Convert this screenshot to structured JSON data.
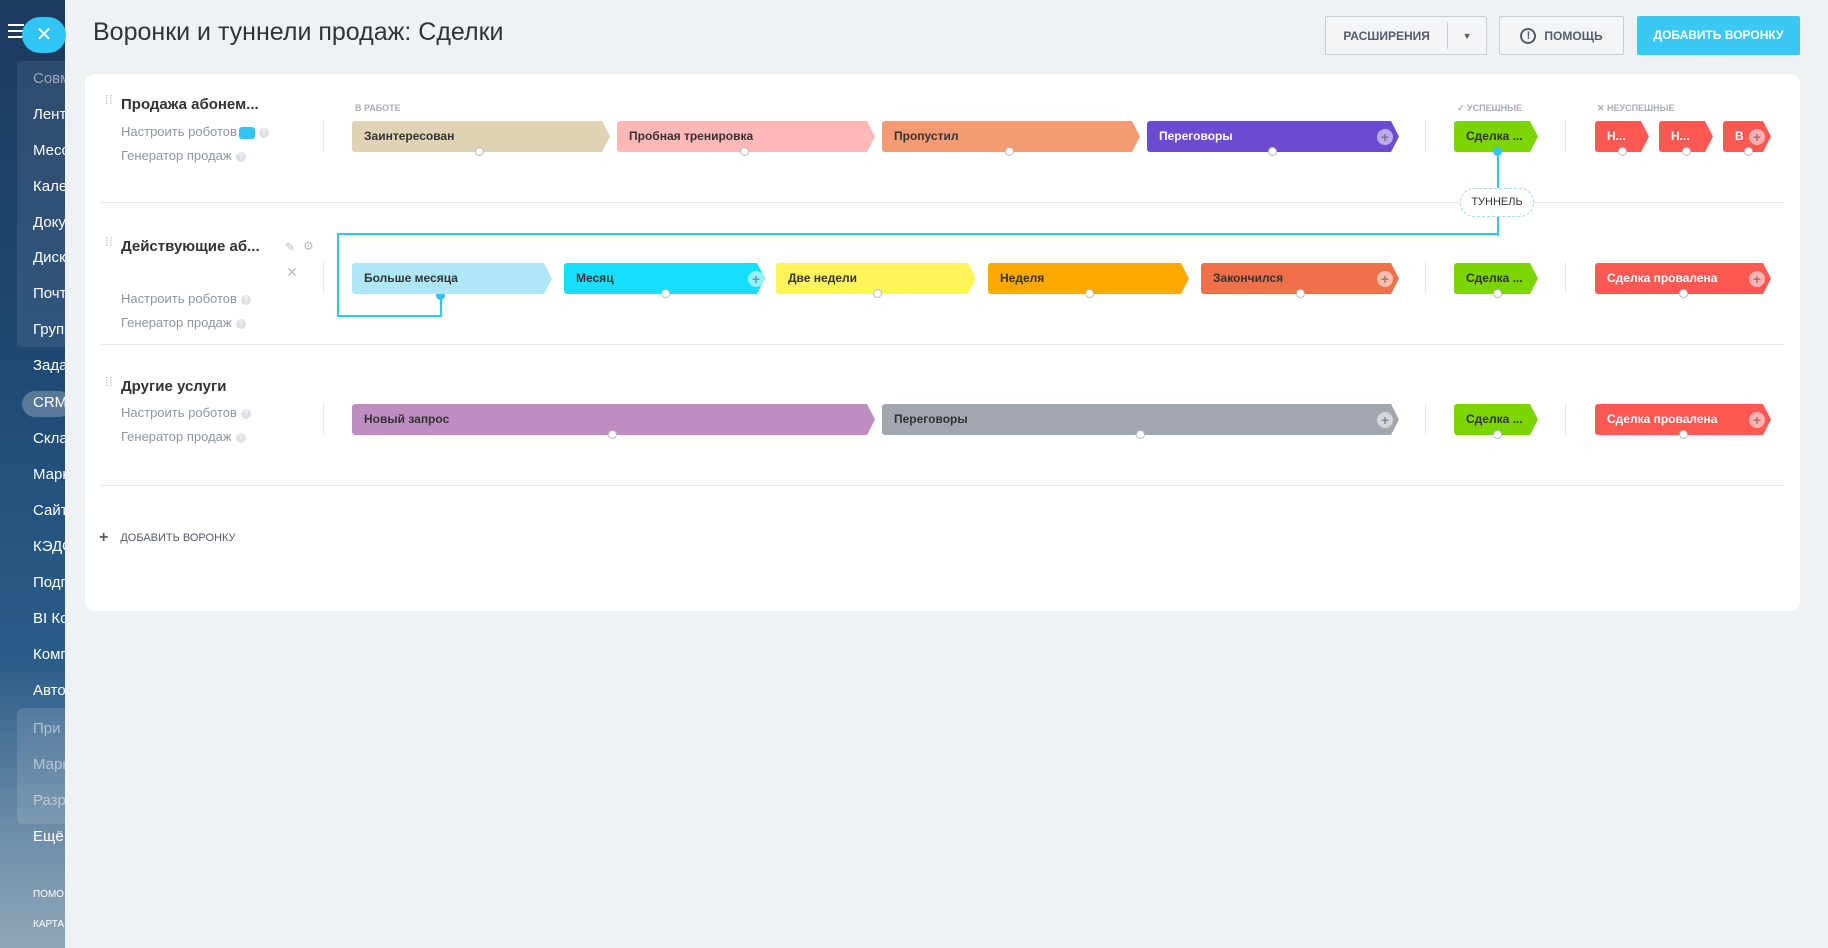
{
  "sidebar": {
    "items": [
      "Совм",
      "Лент",
      "Месс",
      "Кале",
      "Доку",
      "Диск",
      "Почт",
      "Груп",
      "Зада",
      "CRM",
      "Скла",
      "Марк",
      "Сайт",
      "КЭДО",
      "Подп",
      "BI Ко",
      "Комп",
      "Авто",
      "При",
      "Марк",
      "Разр",
      "Ещё",
      "ПОМО",
      "КАРТА"
    ]
  },
  "header": {
    "title": "Воронки и туннели продаж: Сделки",
    "extensions_label": "Расширения",
    "help_label": "Помощь",
    "add_funnel_label": "Добавить воронку"
  },
  "columns": {
    "in_work": "В работе",
    "success": "Успешные",
    "fail": "Неуспешные"
  },
  "tunnel_label": "Туннель",
  "funnels": [
    {
      "name": "Продажа абонем...",
      "robots_link": "Настроить роботов",
      "generator_link": "Генератор продаж",
      "stages": [
        "Заинтересован",
        "Пробная тренировка",
        "Пропустил",
        "Переговоры"
      ],
      "success": "Сделка ...",
      "fails": [
        "Н...",
        "Н...",
        "В"
      ]
    },
    {
      "name": "Действующие аб...",
      "robots_link": "Настроить роботов",
      "generator_link": "Генератор продаж",
      "stages": [
        "Больше месяца",
        "Месяц",
        "Две недели",
        "Неделя",
        "Закончился"
      ],
      "success": "Сделка ...",
      "fails": [
        "Сделка провалена"
      ]
    },
    {
      "name": "Другие услуги",
      "robots_link": "Настроить роботов",
      "generator_link": "Генератор продаж",
      "stages": [
        "Новый запрос",
        "Переговоры"
      ],
      "success": "Сделка ...",
      "fails": [
        "Сделка провалена"
      ]
    }
  ],
  "add_funnel_bottom": "Добавить воронку",
  "colors": {
    "accent": "#2fc6f6",
    "success": "#7bd500",
    "fail": "#ff5752"
  }
}
